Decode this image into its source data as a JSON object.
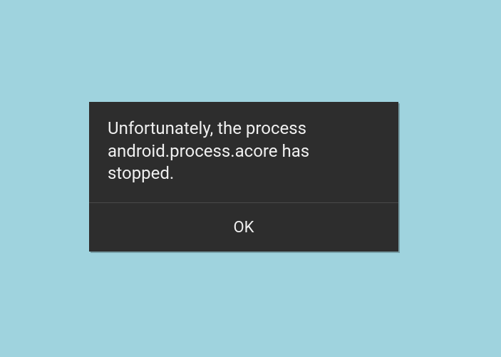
{
  "dialog": {
    "message": "Unfortunately, the process android.process.acore has stopped.",
    "ok_label": "OK"
  }
}
